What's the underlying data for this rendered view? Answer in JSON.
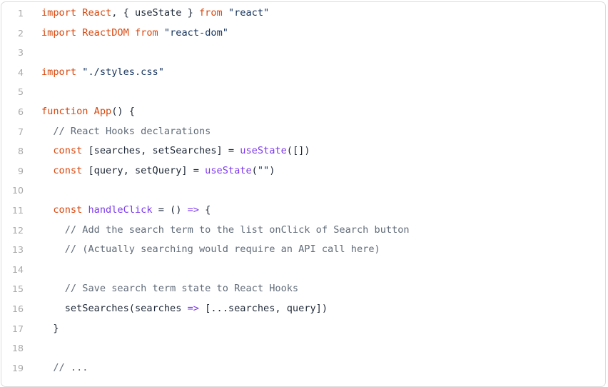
{
  "colors": {
    "keyword": "#d9480f",
    "function_call": "#7c3aed",
    "string": "#14325c",
    "comment": "#606b78",
    "text": "#1f2937",
    "line_number": "#a9a9a9",
    "border": "#dcdcdc"
  },
  "code": {
    "lines": [
      {
        "n": "1",
        "tokens": [
          {
            "t": "import",
            "k": "keyword"
          },
          {
            "t": " ",
            "k": "text"
          },
          {
            "t": "React",
            "k": "name"
          },
          {
            "t": ", { useState } ",
            "k": "text"
          },
          {
            "t": "from",
            "k": "keyword"
          },
          {
            "t": " ",
            "k": "text"
          },
          {
            "t": "\"react\"",
            "k": "string"
          }
        ]
      },
      {
        "n": "2",
        "tokens": [
          {
            "t": "import",
            "k": "keyword"
          },
          {
            "t": " ",
            "k": "text"
          },
          {
            "t": "ReactDOM",
            "k": "name"
          },
          {
            "t": " ",
            "k": "text"
          },
          {
            "t": "from",
            "k": "keyword"
          },
          {
            "t": " ",
            "k": "text"
          },
          {
            "t": "\"react-dom\"",
            "k": "string"
          }
        ]
      },
      {
        "n": "3",
        "tokens": []
      },
      {
        "n": "4",
        "tokens": [
          {
            "t": "import",
            "k": "keyword"
          },
          {
            "t": " ",
            "k": "text"
          },
          {
            "t": "\"./styles.css\"",
            "k": "string"
          }
        ]
      },
      {
        "n": "5",
        "tokens": []
      },
      {
        "n": "6",
        "tokens": [
          {
            "t": "function",
            "k": "keyword"
          },
          {
            "t": " ",
            "k": "text"
          },
          {
            "t": "App",
            "k": "name"
          },
          {
            "t": "() {",
            "k": "text"
          }
        ]
      },
      {
        "n": "7",
        "tokens": [
          {
            "t": "  ",
            "k": "text"
          },
          {
            "t": "// React Hooks declarations",
            "k": "comment"
          }
        ]
      },
      {
        "n": "8",
        "tokens": [
          {
            "t": "  ",
            "k": "text"
          },
          {
            "t": "const",
            "k": "keyword"
          },
          {
            "t": " [searches, setSearches] = ",
            "k": "text"
          },
          {
            "t": "useState",
            "k": "func"
          },
          {
            "t": "([])",
            "k": "text"
          }
        ]
      },
      {
        "n": "9",
        "tokens": [
          {
            "t": "  ",
            "k": "text"
          },
          {
            "t": "const",
            "k": "keyword"
          },
          {
            "t": " [query, setQuery] = ",
            "k": "text"
          },
          {
            "t": "useState",
            "k": "func"
          },
          {
            "t": "(",
            "k": "text"
          },
          {
            "t": "\"\"",
            "k": "string"
          },
          {
            "t": ")",
            "k": "text"
          }
        ]
      },
      {
        "n": "10",
        "tokens": []
      },
      {
        "n": "11",
        "tokens": [
          {
            "t": "  ",
            "k": "text"
          },
          {
            "t": "const",
            "k": "keyword"
          },
          {
            "t": " ",
            "k": "text"
          },
          {
            "t": "handleClick",
            "k": "func"
          },
          {
            "t": " = () ",
            "k": "text"
          },
          {
            "t": "=>",
            "k": "arrow"
          },
          {
            "t": " {",
            "k": "text"
          }
        ]
      },
      {
        "n": "12",
        "tokens": [
          {
            "t": "    ",
            "k": "text"
          },
          {
            "t": "// Add the search term to the list onClick of Search button",
            "k": "comment"
          }
        ]
      },
      {
        "n": "13",
        "tokens": [
          {
            "t": "    ",
            "k": "text"
          },
          {
            "t": "// (Actually searching would require an API call here)",
            "k": "comment"
          }
        ]
      },
      {
        "n": "14",
        "tokens": []
      },
      {
        "n": "15",
        "tokens": [
          {
            "t": "    ",
            "k": "text"
          },
          {
            "t": "// Save search term state to React Hooks",
            "k": "comment"
          }
        ]
      },
      {
        "n": "16",
        "tokens": [
          {
            "t": "    setSearches(searches ",
            "k": "text"
          },
          {
            "t": "=>",
            "k": "arrow"
          },
          {
            "t": " [...searches, query])",
            "k": "text"
          }
        ]
      },
      {
        "n": "17",
        "tokens": [
          {
            "t": "  }",
            "k": "text"
          }
        ]
      },
      {
        "n": "18",
        "tokens": []
      },
      {
        "n": "19",
        "tokens": [
          {
            "t": "  ",
            "k": "text"
          },
          {
            "t": "// ...",
            "k": "comment"
          }
        ]
      }
    ]
  }
}
